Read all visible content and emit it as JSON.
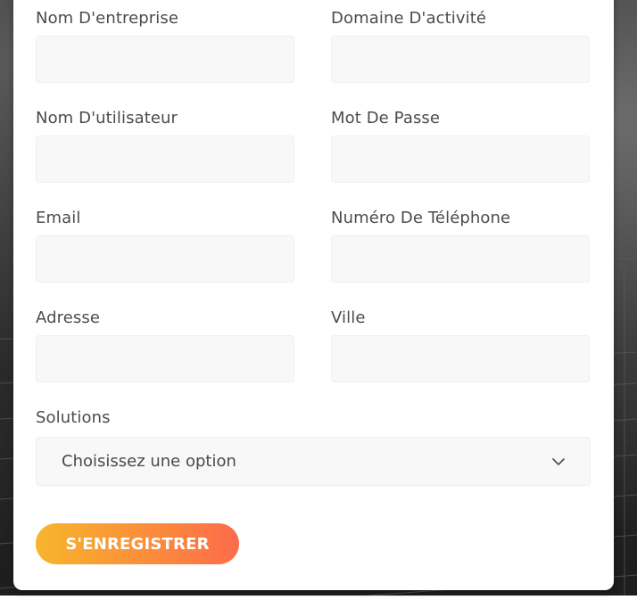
{
  "form": {
    "fields": [
      {
        "label": "Nom D'entreprise",
        "value": ""
      },
      {
        "label": "Domaine D'activité",
        "value": ""
      },
      {
        "label": "Nom D'utilisateur",
        "value": ""
      },
      {
        "label": "Mot De Passe",
        "value": ""
      },
      {
        "label": "Email",
        "value": ""
      },
      {
        "label": "Numéro De Téléphone",
        "value": ""
      },
      {
        "label": "Adresse",
        "value": ""
      },
      {
        "label": "Ville",
        "value": ""
      }
    ],
    "solutions": {
      "label": "Solutions",
      "selected": "Choisissez une option"
    },
    "submit_label": "S'ENREGISTRER"
  },
  "colors": {
    "button_gradient_start": "#f7b52b",
    "button_gradient_end": "#fd6b4b",
    "label_text": "#4b4b4b",
    "field_background": "#f8f8f8"
  }
}
